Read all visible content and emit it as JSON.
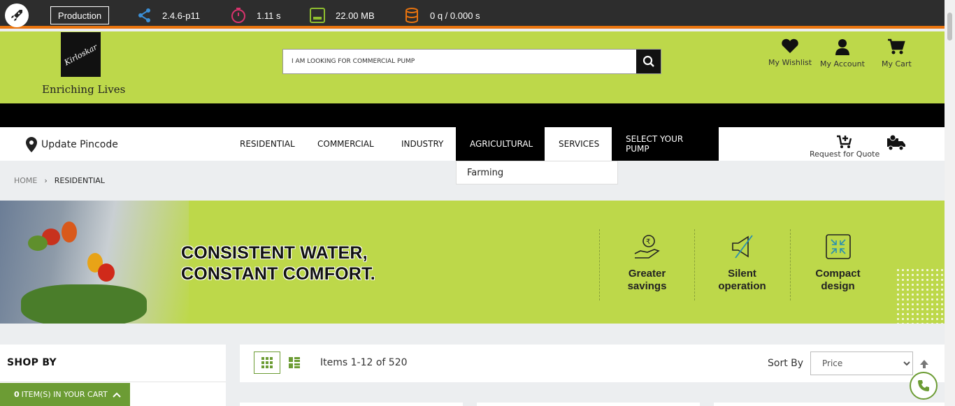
{
  "debugbar": {
    "environment": "Production",
    "version": "2.4.6-p11",
    "time": "1.11 s",
    "memory": "22.00 MB",
    "queries": "0 q / 0.000 s"
  },
  "header": {
    "logo_text": "Kirloskar",
    "tagline": "Enriching Lives",
    "search_value": "I AM LOOKING FOR COMMERCIAL PUMP",
    "wishlist": "My Wishlist",
    "account": "My Account",
    "cart": "My Cart"
  },
  "nav": {
    "pincode": "Update Pincode",
    "items": [
      "RESIDENTIAL",
      "COMMERCIAL",
      "INDUSTRY",
      "AGRICULTURAL",
      "SERVICES",
      "SELECT YOUR PUMP"
    ],
    "dropdown_item": "Farming",
    "quote": "Request for Quote"
  },
  "breadcrumb": {
    "home": "HOME",
    "current": "RESIDENTIAL"
  },
  "banner": {
    "headline_line1": "CONSISTENT WATER,",
    "headline_line2": "CONSTANT COMFORT.",
    "features": [
      {
        "line1": "Greater",
        "line2": "savings",
        "icon": "savings-icon"
      },
      {
        "line1": "Silent",
        "line2": "operation",
        "icon": "silent-icon"
      },
      {
        "line1": "Compact",
        "line2": "design",
        "icon": "compact-icon"
      }
    ]
  },
  "sidebar": {
    "title": "SHOP BY",
    "cart_count": "0",
    "cart_text": "ITEM(S) IN YOUR CART"
  },
  "toolbar": {
    "items_text": "Items 1-12 of 520",
    "sort_label": "Sort By",
    "sort_value": "Price"
  },
  "colors": {
    "brand_green": "#bdd84a",
    "dark_green": "#6c9c34",
    "accent_orange": "#e8730e"
  }
}
